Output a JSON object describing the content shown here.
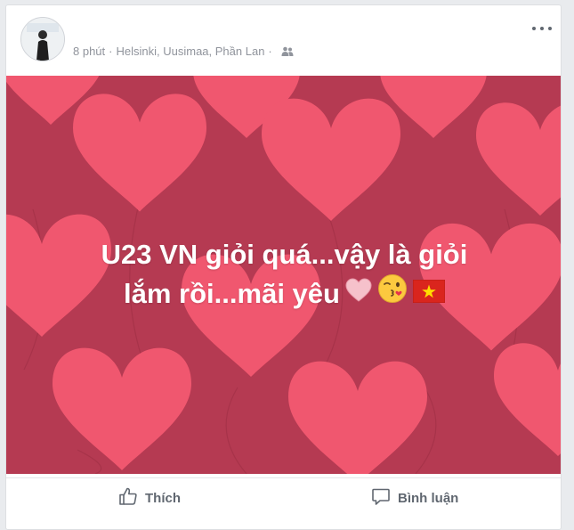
{
  "post": {
    "time": "8 phút",
    "location": "Helsinki, Uusimaa, Phần Lan",
    "separator": "·",
    "audience_icon": "friends-icon",
    "text_line1": "U23 VN giỏi quá...vậy là giỏi",
    "text_line2": "lắm rồi...mãi yêu",
    "emojis": [
      "pink-heart-icon",
      "kissing-face-icon",
      "vietnam-flag-icon"
    ],
    "background_color": "#b53a52",
    "heart_color": "#f0576f"
  },
  "actions": {
    "like_label": "Thích",
    "comment_label": "Bình luận"
  }
}
